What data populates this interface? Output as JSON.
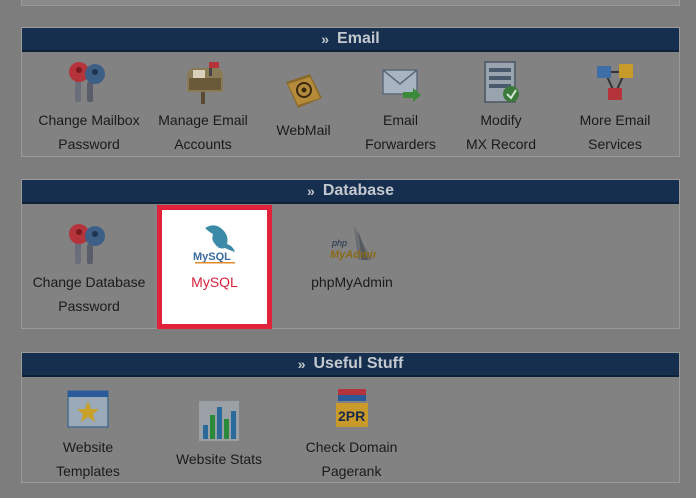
{
  "email": {
    "title": "Email",
    "chevron": "»",
    "items": [
      {
        "line1": "Change Mailbox",
        "line2": "Password",
        "icon": "keys-icon"
      },
      {
        "line1": "Manage Email",
        "line2": "Accounts",
        "icon": "mailbox-icon"
      },
      {
        "line1": "WebMail",
        "line2": "",
        "icon": "address-book-icon"
      },
      {
        "line1": "Email",
        "line2": "Forwarders",
        "icon": "forward-envelope-icon"
      },
      {
        "line1": "Modify",
        "line2": "MX Record",
        "icon": "mx-record-icon"
      },
      {
        "line1": "More Email",
        "line2": "Services",
        "icon": "network-icon"
      }
    ]
  },
  "database": {
    "title": "Database",
    "chevron": "»",
    "items": [
      {
        "line1": "Change Database",
        "line2": "Password",
        "icon": "keys-icon"
      },
      {
        "line1": "MySQL",
        "line2": "",
        "icon": "mysql-dolphin-icon",
        "logo_text": "MySQL",
        "highlighted": true,
        "highlight_color": "#e0223a"
      },
      {
        "line1": "phpMyAdmin",
        "line2": "",
        "icon": "phpmyadmin-icon",
        "logo_text_1": "php",
        "logo_text_2": "MyAdmin"
      }
    ]
  },
  "useful": {
    "title": "Useful Stuff",
    "chevron": "»",
    "items": [
      {
        "line1": "Website",
        "line2": "Templates",
        "icon": "template-star-icon"
      },
      {
        "line1": "Website Stats",
        "line2": "",
        "icon": "bar-chart-icon"
      },
      {
        "line1": "Check Domain",
        "line2": "Pagerank",
        "icon": "pagerank-icon",
        "logo_text": "2PR"
      }
    ]
  },
  "colors": {
    "header_bg": "#172f4e",
    "page_bg": "#7d7d7d",
    "highlight": "#e0223a"
  }
}
